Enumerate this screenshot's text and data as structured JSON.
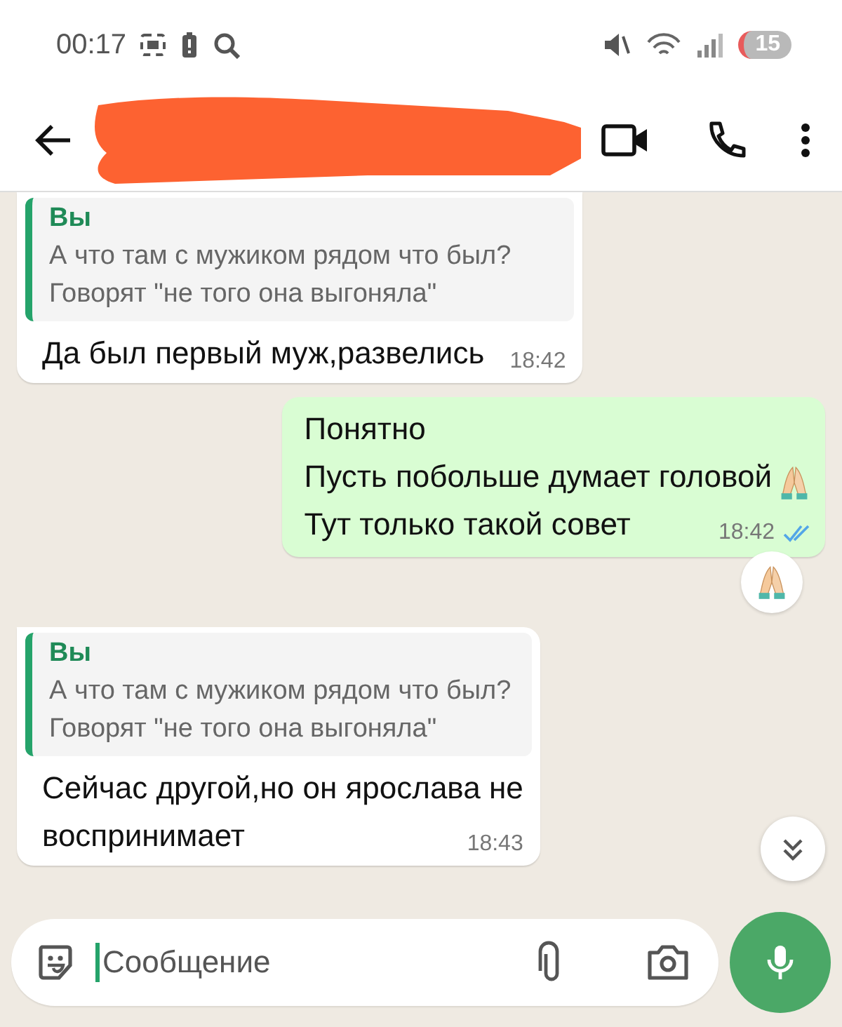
{
  "status_bar": {
    "time": "00:17",
    "notification_count": "15"
  },
  "header": {
    "name_redacted": true
  },
  "messages": [
    {
      "outgoing": false,
      "quote": {
        "author": "Вы",
        "lines": [
          "А что там с мужиком рядом что был?",
          "Говорят \"не того она выгоняла\""
        ]
      },
      "lines": [
        {
          "text": "Да был первый муж,развелись",
          "praying_emoji": false
        }
      ],
      "time": "18:42"
    },
    {
      "outgoing": true,
      "lines": [
        {
          "text": "Понятно",
          "praying_emoji": false
        },
        {
          "text": "Пусть побольше думает головой",
          "praying_emoji": true
        },
        {
          "text": "Тут только такой совет",
          "praying_emoji": false
        }
      ],
      "time": "18:42",
      "read": true,
      "praying_reaction": true
    },
    {
      "outgoing": false,
      "quote": {
        "author": "Вы",
        "lines": [
          "А что там с мужиком рядом что был?",
          "Говорят \"не того она выгоняла\""
        ]
      },
      "lines": [
        {
          "text": "Сейчас другой,но он ярослава не",
          "praying_emoji": false
        },
        {
          "text": "воспринимает",
          "praying_emoji": false
        }
      ],
      "time": "18:43"
    }
  ],
  "composer": {
    "placeholder": "Сообщение"
  }
}
